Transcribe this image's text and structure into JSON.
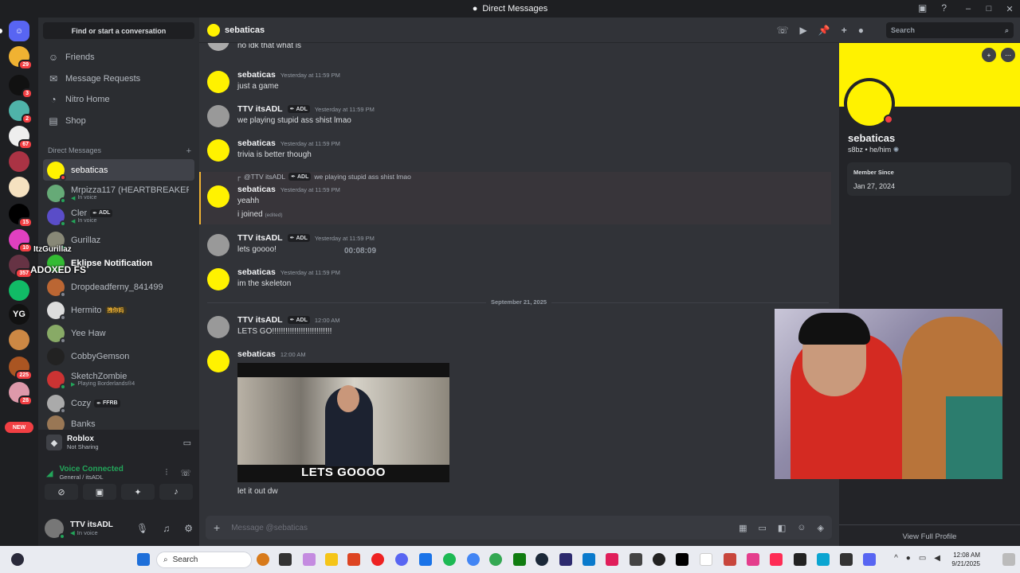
{
  "window": {
    "title": "Direct Messages"
  },
  "sidebar": {
    "find_placeholder": "Find or start a conversation",
    "nav": [
      {
        "label": "Friends"
      },
      {
        "label": "Message Requests"
      },
      {
        "label": "Nitro Home"
      },
      {
        "label": "Shop"
      }
    ],
    "dm_header": "Direct Messages",
    "dms": [
      {
        "name": "sebaticas",
        "sub": "",
        "tag": ""
      },
      {
        "name": "Mrpizza117 (HEARTBREAKER...",
        "sub": "In voice",
        "tag": ""
      },
      {
        "name": "Cler",
        "sub": "In voice",
        "tag": "ADL"
      },
      {
        "name": "Gurillaz",
        "sub": "",
        "tag": ""
      },
      {
        "name": "Eklipse Notification",
        "sub": "",
        "tag": ""
      },
      {
        "name": "Dropdeadferny_841499",
        "sub": "",
        "tag": ""
      },
      {
        "name": "Hermito",
        "sub": "",
        "tag": "拽你妈"
      },
      {
        "name": "Yee Haw",
        "sub": "",
        "tag": ""
      },
      {
        "name": "CobbyGemson",
        "sub": "",
        "tag": ""
      },
      {
        "name": "SketchZombie",
        "sub": "Playing Borderlands®4",
        "tag": ""
      },
      {
        "name": "Cozy",
        "sub": "",
        "tag": "FFRB"
      },
      {
        "name": "Banks",
        "sub": "",
        "tag": ""
      }
    ],
    "overlay_name": "ItzGurillaz",
    "overlay_banner": "ADOXED FS"
  },
  "servers": {
    "badges": [
      "29",
      "3",
      "2",
      "67",
      "15",
      "10",
      "357",
      "225",
      "28"
    ],
    "yg": "YG",
    "new": "NEW"
  },
  "activity": {
    "name": "Roblox",
    "status": "Not Sharing"
  },
  "voice": {
    "title": "Voice Connected",
    "channel": "General / itsADL"
  },
  "user": {
    "name": "TTV itsADL",
    "status": "In voice"
  },
  "chat": {
    "channel": "sebaticas",
    "search_placeholder": "Search",
    "composer_placeholder": "Message @sebaticas",
    "timer": "00:08:09",
    "date_divider": "September 21, 2025",
    "reply": {
      "user": "@TTV itsADL",
      "tag": "ADL",
      "text": "we playing stupid ass shist lmao"
    },
    "messages": [
      {
        "author": "",
        "time": "",
        "lines": [
          "no idk that what is"
        ],
        "tag": ""
      },
      {
        "author": "sebaticas",
        "time": "Yesterday at 11:59 PM",
        "lines": [
          "just a game"
        ],
        "tag": ""
      },
      {
        "author": "TTV itsADL",
        "time": "Yesterday at 11:59 PM",
        "lines": [
          "we playing stupid ass shist lmao"
        ],
        "tag": "ADL"
      },
      {
        "author": "sebaticas",
        "time": "Yesterday at 11:59 PM",
        "lines": [
          "trivia is better though"
        ],
        "tag": ""
      },
      {
        "author": "sebaticas",
        "time": "Yesterday at 11:59 PM",
        "lines": [
          "yeahh",
          "i joined"
        ],
        "tag": "",
        "edited": "(edited)"
      },
      {
        "author": "TTV itsADL",
        "time": "Yesterday at 11:59 PM",
        "lines": [
          "lets goooo!"
        ],
        "tag": "ADL"
      },
      {
        "author": "sebaticas",
        "time": "Yesterday at 11:59 PM",
        "lines": [
          "im the skeleton"
        ],
        "tag": ""
      },
      {
        "author": "TTV itsADL",
        "time": "12:00 AM",
        "lines": [
          "LETS GO!!!!!!!!!!!!!!!!!!!!!!!!!!!"
        ],
        "tag": "ADL"
      },
      {
        "author": "sebaticas",
        "time": "12:00 AM",
        "lines": [
          "let it out dw"
        ],
        "tag": "",
        "gif_caption": "LETS GOOOO"
      }
    ]
  },
  "profile": {
    "name": "sebaticas",
    "tagline": "s8bz • he/him",
    "member_since_label": "Member Since",
    "member_since": "Jan 27, 2024",
    "view_full": "View Full Profile"
  },
  "taskbar": {
    "search": "Search",
    "time": "12:08 AM",
    "date": "9/21/2025"
  },
  "colors": {
    "blurple": "#5865f2",
    "green": "#23a55a",
    "red": "#f23f43",
    "yellow": "#fff200"
  }
}
